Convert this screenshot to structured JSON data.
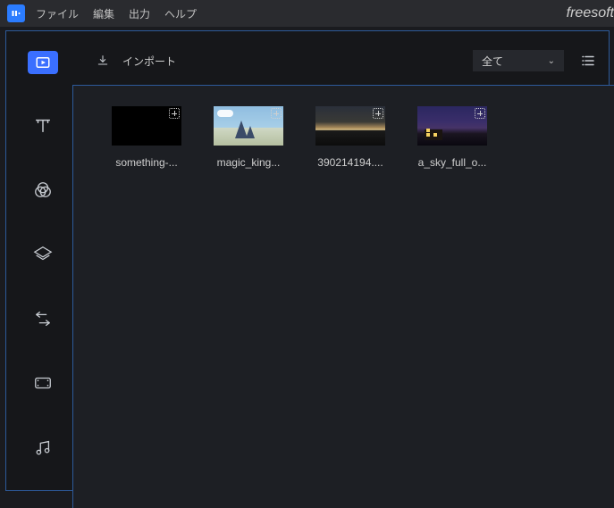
{
  "menubar": {
    "items": [
      "ファイル",
      "編集",
      "出力",
      "ヘルプ"
    ]
  },
  "watermark": "freesoft",
  "toolbar": {
    "import_label": "インポート"
  },
  "filter": {
    "selected": "全て"
  },
  "media": {
    "items": [
      {
        "label": "something-..."
      },
      {
        "label": "magic_king..."
      },
      {
        "label": "390214194...."
      },
      {
        "label": "a_sky_full_o..."
      }
    ]
  }
}
